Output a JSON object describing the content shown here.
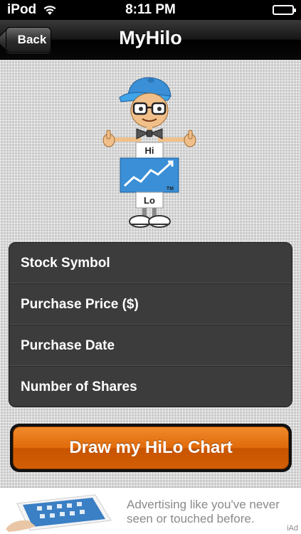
{
  "status_bar": {
    "carrier": "iPod",
    "time": "8:11 PM"
  },
  "nav": {
    "back_label": "Back",
    "title": "MyHilo"
  },
  "mascot": {
    "hi_label": "Hi",
    "lo_label": "Lo",
    "tm_label": "TM"
  },
  "form": {
    "fields": [
      {
        "label": "Stock Symbol"
      },
      {
        "label": "Purchase Price ($)"
      },
      {
        "label": "Purchase Date"
      },
      {
        "label": "Number of Shares"
      }
    ]
  },
  "action": {
    "draw_label": "Draw my HiLo Chart"
  },
  "ad": {
    "line1": "Advertising like you've never",
    "line2": "seen or touched before.",
    "tag": "iAd"
  },
  "colors": {
    "accent_orange": "#e06a0a",
    "nav_dark": "#151515",
    "form_bg": "#3c3c3c",
    "mascot_blue": "#3a8fd6"
  }
}
